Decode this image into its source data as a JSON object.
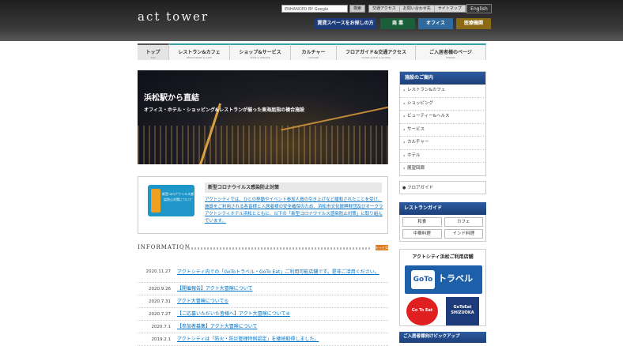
{
  "header": {
    "logo": "act tower",
    "search_placeholder": "ENHANCED BY Google",
    "search_button": "検索",
    "top_links": [
      "交通アクセス",
      "お問い合わせ先",
      "サイトマップ"
    ],
    "language": "English",
    "buttons": [
      "賃貸スペースをお探しの方",
      "商 業",
      "オフィス",
      "医療機関"
    ]
  },
  "nav": [
    {
      "label": "トップ",
      "sub": "TOP"
    },
    {
      "label": "レストラン&カフェ",
      "sub": "RESTAURANT & CAFE"
    },
    {
      "label": "ショップ&サービス",
      "sub": "SHOP & SERVICE"
    },
    {
      "label": "カルチャー",
      "sub": "CULTURE"
    },
    {
      "label": "フロアガイド&交通アクセス",
      "sub": "FLOOR GUIDE & ACCESS"
    },
    {
      "label": "ご入居者様のページ",
      "sub": "TENANT"
    }
  ],
  "hero": {
    "title": "浜松駅から直結",
    "subtitle": "オフィス・ホテル・ショッピング&レストランが揃った東海屈指の複合施設"
  },
  "notice": {
    "image_text": "新型コロナウイルス感染防止対策について",
    "title": "新型コロナウイルス感染防止対策",
    "text": "アクトシティでは、ひとの移動やイベント参加人員の引き上げなど緩和されたことを受け、施設をご利用される各皆様と入居者様の安全確保のため、浜松市文化振興財団及びオークラアクトシティホテル浜松とともに、以下の「新型コロナウイルス感染防止対策」に取り組んでいます。"
  },
  "information": {
    "heading": "INFORMATION",
    "more": "もっと見る",
    "items": [
      {
        "date": "2020.11.27",
        "text": "アクトシティ内での「GoToトラベル・GoTo Eat」ご利用可能店舗です。是非ご活用ください。"
      },
      {
        "date": "2020.9.26",
        "text": "【開催報告】アクト大冒険について"
      },
      {
        "date": "2020.7.31",
        "text": "アクト大冒険について⑤"
      },
      {
        "date": "2020.7.27",
        "text": "【ご応募いただいた皆様へ】アクト大冒険について④"
      },
      {
        "date": "2020.7.1",
        "text": "【参加者募集】アクト大冒険について"
      },
      {
        "date": "2019.2.1",
        "text": "アクトシティは「防火・防災管理特例認定」を継続取得しました。"
      }
    ]
  },
  "sidebar": {
    "facility_heading": "施設のご案内",
    "facilities": [
      "レストラン&カフェ",
      "ショッピング",
      "ビューティー&ヘルス",
      "サービス",
      "カルチャー",
      "ホテル",
      "展望回廊"
    ],
    "floor_guide": "フロアガイド",
    "restaurant_heading": "レストランガイド",
    "restaurants": [
      "和食",
      "カフェ",
      "中華料理",
      "インド料理"
    ],
    "goto_heading": "アクトシティ浜松ご利用店舗",
    "goto_travel": "トラベル",
    "goto_eat1": "Go To Eat",
    "goto_eat2": "GoToEat SHIZUOKA",
    "pickup_heading": "ご入居者様向けピックアップ"
  }
}
